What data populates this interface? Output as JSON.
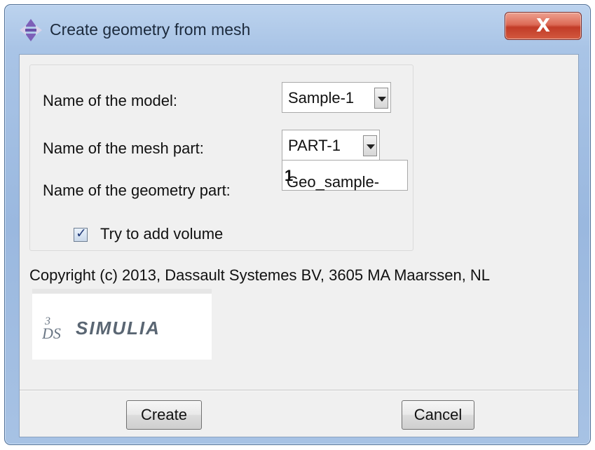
{
  "window": {
    "title": "Create geometry from mesh",
    "close_label": "X"
  },
  "form": {
    "model_label": "Name of the model:",
    "model_value": "Sample-1",
    "mesh_part_label": "Name of the mesh part:",
    "mesh_part_value": "PART-1",
    "geometry_part_label": "Name of the geometry part:",
    "geometry_part_value_prefix": "Geo_sample-",
    "geometry_part_value_bold": "1",
    "volume_checkbox_label": "Try to add volume",
    "volume_checked": true
  },
  "copyright": "Copyright (c) 2013, Dassault Systemes BV, 3605 MA Maarssen, NL",
  "logo": {
    "text": "SIMULIA",
    "icon": "ds-logo-icon"
  },
  "buttons": {
    "create_label": "Create",
    "cancel_label": "Cancel"
  },
  "colors": {
    "titlebar": "#a9c4e6",
    "close_button": "#c94a35",
    "client_background": "#f0f0f0"
  }
}
